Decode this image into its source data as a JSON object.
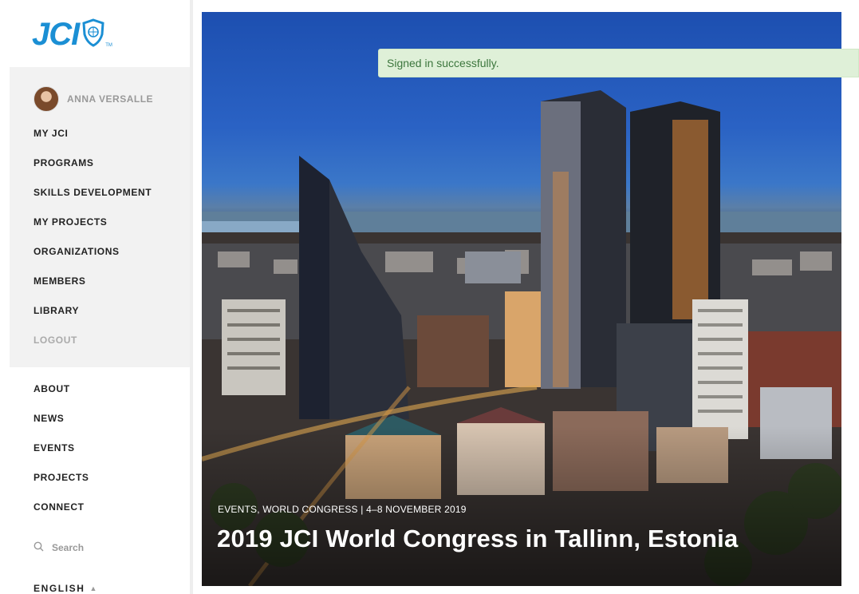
{
  "brand": {
    "logo_text": "JCI",
    "trademark": "TM"
  },
  "user": {
    "name": "ANNA VERSALLE"
  },
  "user_nav": [
    {
      "label": "MY JCI"
    },
    {
      "label": "PROGRAMS"
    },
    {
      "label": "SKILLS DEVELOPMENT"
    },
    {
      "label": "MY PROJECTS"
    },
    {
      "label": "ORGANIZATIONS"
    },
    {
      "label": "MEMBERS"
    },
    {
      "label": "LIBRARY"
    },
    {
      "label": "LOGOUT"
    }
  ],
  "main_nav": [
    {
      "label": "ABOUT"
    },
    {
      "label": "NEWS"
    },
    {
      "label": "EVENTS"
    },
    {
      "label": "PROJECTS"
    },
    {
      "label": "CONNECT"
    }
  ],
  "search": {
    "label": "Search"
  },
  "language": {
    "label": "ENGLISH",
    "caret_icon": "caret-up-icon"
  },
  "hero": {
    "meta": "EVENTS, WORLD CONGRESS | 4–8 NOVEMBER 2019",
    "title": "2019 JCI World Congress in Tallinn, Estonia"
  },
  "flash": {
    "message": "Signed in successfully."
  },
  "colors": {
    "brand_blue": "#1b8fd4",
    "flash_bg": "#dff0d8",
    "flash_text": "#3c763d",
    "muted": "#aaaaaa"
  }
}
